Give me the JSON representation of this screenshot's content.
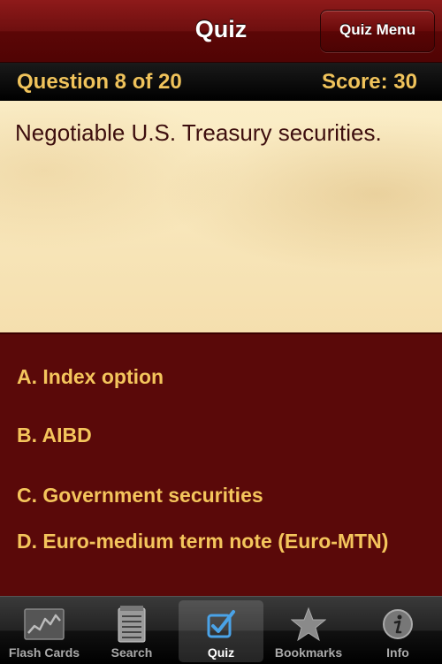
{
  "navbar": {
    "title": "Quiz",
    "menu_button": "Quiz Menu"
  },
  "status": {
    "question_label": "Question 8 of 20",
    "score_label": "Score: 30"
  },
  "question": {
    "text": "Negotiable U.S. Treasury securities."
  },
  "answers": [
    {
      "text": "A. Index option"
    },
    {
      "text": "B. AIBD"
    },
    {
      "text": "C. Government securities"
    },
    {
      "text": "D. Euro-medium term note (Euro-MTN)"
    }
  ],
  "tabs": [
    {
      "label": "Flash Cards",
      "icon": "chart-icon"
    },
    {
      "label": "Search",
      "icon": "notepad-icon"
    },
    {
      "label": "Quiz",
      "icon": "checkbox-icon",
      "active": true
    },
    {
      "label": "Bookmarks",
      "icon": "star-icon"
    },
    {
      "label": "Info",
      "icon": "info-icon"
    }
  ],
  "colors": {
    "navbar": "#6e0f0f",
    "status_text": "#f0c35b",
    "card_bg": "#f8e7bd",
    "question_text": "#3d0e0e",
    "answers_bg": "#5a0909",
    "answer_text": "#f4c55c",
    "tab_active": "#4aa3e8"
  }
}
